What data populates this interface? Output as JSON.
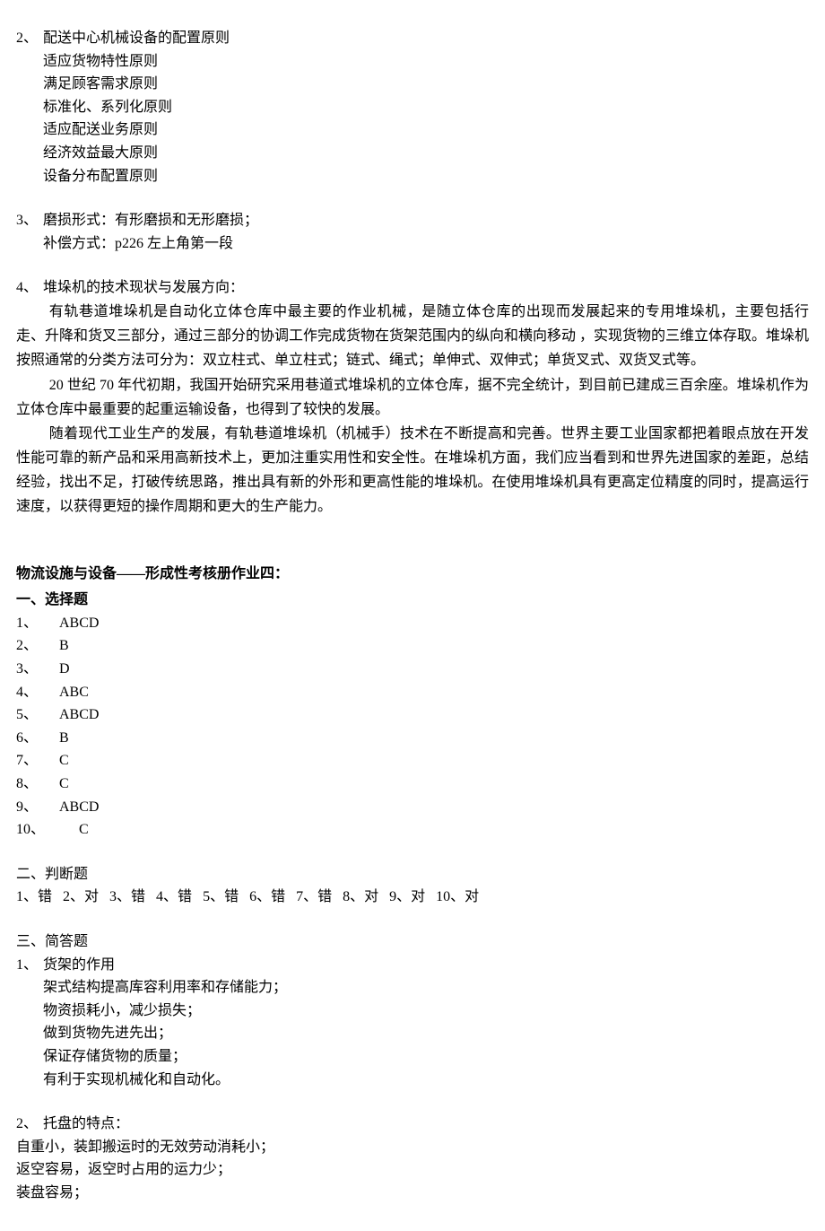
{
  "q2": {
    "num": "2、",
    "title": "配送中心机械设备的配置原则",
    "items": [
      "适应货物特性原则",
      "满足顾客需求原则",
      "标准化、系列化原则",
      "适应配送业务原则",
      "经济效益最大原则",
      "设备分布配置原则"
    ]
  },
  "q3": {
    "num": "3、",
    "line1": "磨损形式：有形磨损和无形磨损；",
    "line2": "补偿方式：p226 左上角第一段"
  },
  "q4": {
    "num": "4、",
    "title": "堆垛机的技术现状与发展方向：",
    "p1": "有轨巷道堆垛机是自动化立体仓库中最主要的作业机械，是随立体仓库的出现而发展起来的专用堆垛机，主要包括行走、升降和货叉三部分，通过三部分的协调工作完成货物在货架范围内的纵向和横向移动 ，实现货物的三维立体存取。堆垛机按照通常的分类方法可分为：双立柱式、单立柱式；链式、绳式；单伸式、双伸式；单货叉式、双货叉式等。",
    "p2": "20 世纪 70 年代初期，我国开始研究采用巷道式堆垛机的立体仓库，据不完全统计，到目前已建成三百余座。堆垛机作为立体仓库中最重要的起重运输设备，也得到了较快的发展。",
    "p3": "随着现代工业生产的发展，有轨巷道堆垛机（机械手）技术在不断提高和完善。世界主要工业国家都把着眼点放在开发性能可靠的新产品和采用高新技术上，更加注重实用性和安全性。在堆垛机方面，我们应当看到和世界先进国家的差距，总结经验，找出不足，打破传统思路，推出具有新的外形和更高性能的堆垛机。在使用堆垛机具有更高定位精度的同时，提高运行速度，以获得更短的操作周期和更大的生产能力。"
  },
  "section4": {
    "title": "物流设施与设备——形成性考核册作业四：",
    "part1": {
      "heading": "一、选择题",
      "answers": [
        {
          "n": "1、",
          "v": "ABCD"
        },
        {
          "n": "2、",
          "v": "B"
        },
        {
          "n": "3、",
          "v": "D"
        },
        {
          "n": "4、",
          "v": "ABC"
        },
        {
          "n": "5、",
          "v": "ABCD"
        },
        {
          "n": "6、",
          "v": "B"
        },
        {
          "n": "7、",
          "v": "C"
        },
        {
          "n": "8、",
          "v": "C"
        },
        {
          "n": "9、",
          "v": "ABCD"
        },
        {
          "n": "10、",
          "v": "C"
        }
      ]
    },
    "part2": {
      "heading": "二、判断题",
      "answers": [
        "1、错",
        "2、对",
        "3、错",
        "4、错",
        "5、错",
        "6、错",
        "7、错",
        "8、对",
        "9、对",
        "10、对"
      ]
    },
    "part3": {
      "heading": "三、简答题",
      "q1": {
        "num": "1、",
        "title": "货架的作用",
        "items": [
          "架式结构提高库容利用率和存储能力；",
          "物资损耗小，减少损失；",
          "做到货物先进先出；",
          "保证存储货物的质量；",
          "有利于实现机械化和自动化。"
        ]
      },
      "q2": {
        "num": "2、",
        "title": "托盘的特点：",
        "items": [
          "自重小，装卸搬运时的无效劳动消耗小；",
          "返空容易，返空时占用的运力少；",
          "装盘容易；"
        ]
      }
    }
  }
}
